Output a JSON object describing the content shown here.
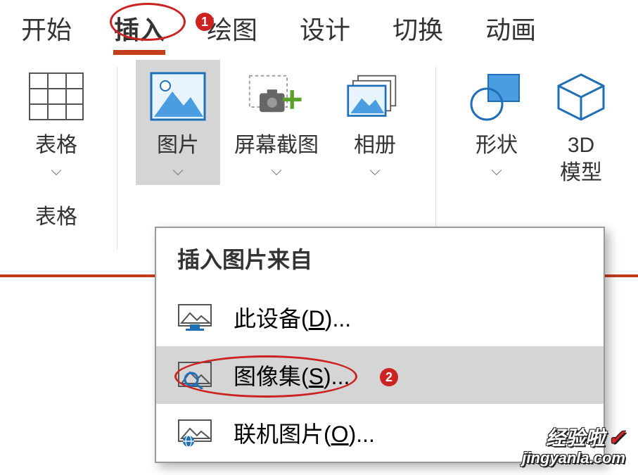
{
  "tabs": {
    "home": "开始",
    "insert": "插入",
    "draw": "绘图",
    "design": "设计",
    "transition": "切换",
    "animation": "动画"
  },
  "ribbon": {
    "table": "表格",
    "table_group": "表格",
    "picture": "图片",
    "screenshot": "屏幕截图",
    "album": "相册",
    "shapes": "形状",
    "model3d_line1": "3D",
    "model3d_line2": "模型"
  },
  "dropdown": {
    "header": "插入图片来自",
    "device_prefix": "此设备(",
    "device_key": "D",
    "device_suffix": ")...",
    "imageset_prefix": "图像集(",
    "imageset_key": "S",
    "imageset_suffix": ")...",
    "online_prefix": "联机图片(",
    "online_key": "O",
    "online_suffix": ")..."
  },
  "annotations": {
    "badge1": "1",
    "badge2": "2"
  },
  "watermark": {
    "line1": "经验啦",
    "line2": "jingyanla.com"
  }
}
